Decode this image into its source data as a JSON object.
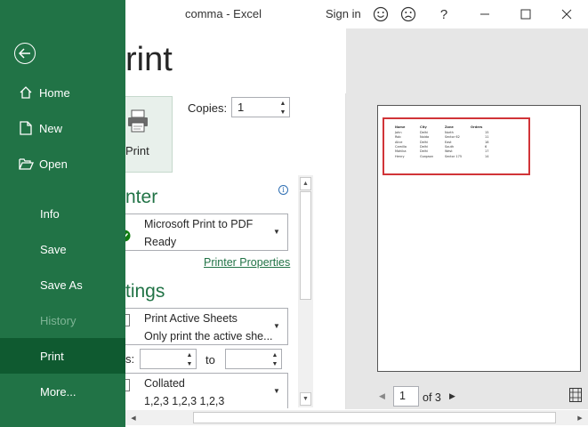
{
  "window": {
    "title": "comma  -  Excel",
    "sign_in": "Sign in",
    "help": "?",
    "minimize": "—",
    "close": "✕"
  },
  "sidebar": {
    "items": [
      {
        "label": "Home"
      },
      {
        "label": "New"
      },
      {
        "label": "Open"
      },
      {
        "label": "Info"
      },
      {
        "label": "Save"
      },
      {
        "label": "Save As"
      },
      {
        "label": "History"
      },
      {
        "label": "Print"
      },
      {
        "label": "More..."
      }
    ]
  },
  "print": {
    "title": "rint",
    "button_label": "Print",
    "copies_label": "Copies:",
    "copies_value": "1"
  },
  "printer": {
    "heading": "nter",
    "name": "Microsoft Print to PDF",
    "status": "Ready",
    "properties_link": "Printer Properties"
  },
  "settings": {
    "heading": "tings",
    "scope_title": "Print Active Sheets",
    "scope_desc": "Only print the active she...",
    "pages_label": "s:",
    "pages_from": "",
    "to_label": "to",
    "pages_to": "",
    "collate_title": "Collated",
    "collate_desc": "1,2,3    1,2,3    1,2,3"
  },
  "preview": {
    "current_page": "1",
    "of_pages": "of 3",
    "table": {
      "headers": [
        "Name",
        "City",
        "Zone",
        "Orders"
      ],
      "rows": [
        [
          "John",
          "Delhi",
          "North",
          "15"
        ],
        [
          "Rob",
          "Noida",
          "Sector 62",
          "11"
        ],
        [
          "Alice",
          "Delhi",
          "East",
          "18"
        ],
        [
          "Camilla",
          "Delhi",
          "South",
          "6"
        ],
        [
          "Mahika",
          "Delhi",
          "West",
          "17"
        ],
        [
          "Henry",
          "Gurgaon",
          "Sector 175",
          "14"
        ]
      ]
    }
  }
}
